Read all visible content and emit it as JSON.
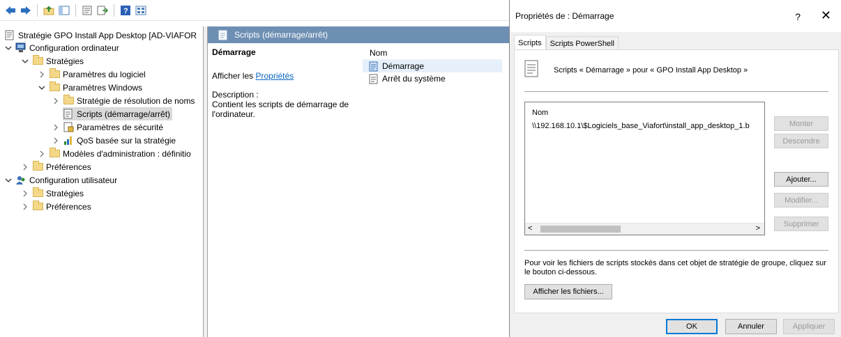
{
  "toolbar": {
    "icons": [
      "back-arrow-icon",
      "forward-arrow-icon",
      "up-folder-icon",
      "show-hide-tree-icon",
      "properties-icon",
      "export-list-icon",
      "help-icon",
      "view-icon"
    ]
  },
  "tree": {
    "root_label": "Stratégie GPO Install App Desktop [AD-VIAFOR",
    "computer_config": "Configuration ordinateur",
    "strategies": "Stratégies",
    "software_settings": "Paramètres du logiciel",
    "windows_settings": "Paramètres Windows",
    "name_resolution": "Stratégie de résolution de noms",
    "scripts": "Scripts (démarrage/arrêt)",
    "security_settings": "Paramètres de sécurité",
    "qos": "QoS basée sur la stratégie",
    "admin_templates": "Modèles d'administration : définitio",
    "preferences": "Préférences",
    "user_config": "Configuration utilisateur",
    "user_strategies": "Stratégies",
    "user_preferences": "Préférences"
  },
  "middle": {
    "header": "Scripts (démarrage/arrêt)",
    "title": "Démarrage",
    "show_prefix": "Afficher les ",
    "show_link": "Propriétés",
    "description_label": "Description :",
    "description_text": "Contient les scripts de démarrage de l'ordinateur.",
    "list_column": "Nom",
    "list_items": [
      "Démarrage",
      "Arrêt du système"
    ]
  },
  "dialog": {
    "title": "Propriétés de : Démarrage",
    "help": "?",
    "close": "✕",
    "tabs": [
      "Scripts",
      "Scripts PowerShell"
    ],
    "script_header": "Scripts « Démarrage » pour « GPO Install App Desktop »",
    "list_col": "Nom",
    "list_row": "\\\\192.168.10.1\\$Logiciels_base_Viafort\\install_app_desktop_1.b",
    "btn_up": "Monter",
    "btn_down": "Descendre",
    "btn_add": "Ajouter...",
    "btn_edit": "Modifier...",
    "btn_remove": "Supprimer",
    "info_text": "Pour voir les fichiers de scripts stockés dans cet objet de stratégie de groupe, cliquez sur le bouton ci-dessous.",
    "btn_show_files": "Afficher les fichiers...",
    "btn_ok": "OK",
    "btn_cancel": "Annuler",
    "btn_apply": "Appliquer"
  }
}
